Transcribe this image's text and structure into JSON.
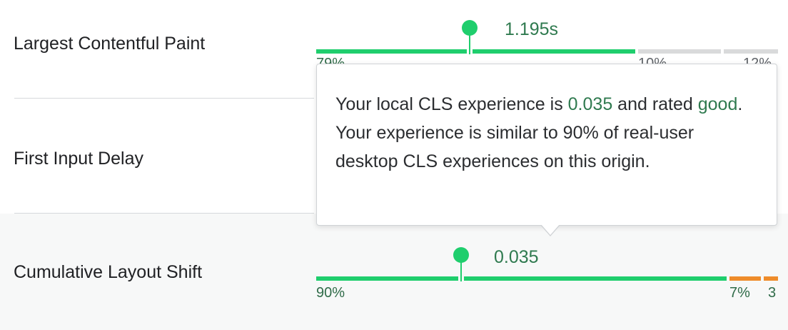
{
  "metrics": {
    "lcp": {
      "name": "Largest Contentful Paint",
      "value": "1.195s",
      "good_pct": "79%",
      "ni_pct": "10%",
      "poor_pct": "12%"
    },
    "fid": {
      "name": "First Input Delay"
    },
    "cls": {
      "name": "Cumulative Layout Shift",
      "value": "0.035",
      "good_pct": "90%",
      "ni_pct": "7%",
      "poor_pct": "3"
    }
  },
  "tooltip": {
    "part1": "Your local CLS experience is ",
    "value": "0.035",
    "part2": " and rated ",
    "rating": "good",
    "part3": ". Your experience is similar to 90% of real-user desktop CLS experiences on this origin."
  },
  "colors": {
    "good": "#1fce6d",
    "needs_improvement": "#d9dadb",
    "orange": "#ee8c2b",
    "value_text": "#2f7a4f"
  }
}
